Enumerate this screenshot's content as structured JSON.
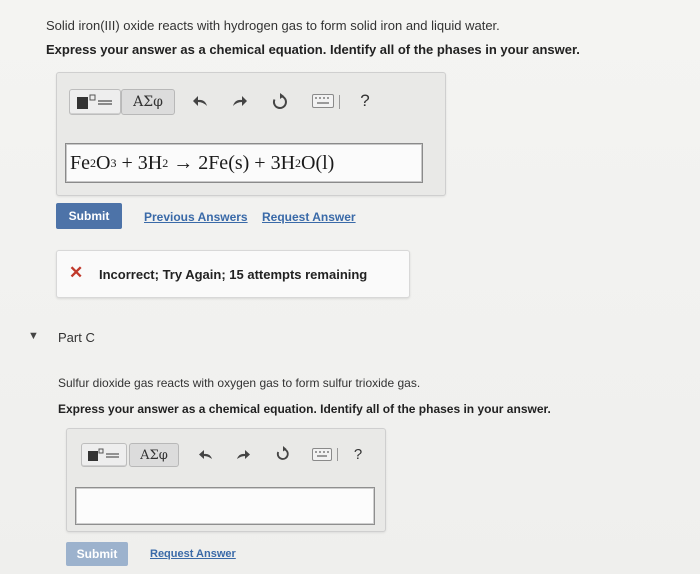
{
  "part_b": {
    "prompt": "Solid iron(III) oxide reacts with hydrogen gas to form solid iron and liquid water.",
    "instruction": "Express your answer as a chemical equation. Identify all of the phases in your answer.",
    "toolbar": {
      "greek_label": "ΑΣφ",
      "help_label": "?"
    },
    "equation": {
      "t1": "Fe",
      "s1": "2",
      "t2": "O",
      "s2": "3",
      "t3": " + 3H",
      "s3": "2",
      "t4": " → 2Fe(s) + 3H",
      "s4": "2",
      "t5": "O(l)"
    },
    "submit_label": "Submit",
    "previous_answers_label": "Previous Answers",
    "request_answer_label": "Request Answer",
    "feedback_icon": "✕",
    "feedback_text": "Incorrect; Try Again; 15 attempts remaining"
  },
  "part_c": {
    "caret": "▼",
    "title": "Part C",
    "prompt": "Sulfur dioxide gas reacts with oxygen gas to form sulfur trioxide gas.",
    "instruction": "Express your answer as a chemical equation. Identify all of the phases in your answer.",
    "toolbar": {
      "greek_label": "ΑΣφ",
      "help_label": "?"
    },
    "answer_value": "",
    "submit_label": "Submit",
    "request_answer_label": "Request Answer"
  },
  "colors": {
    "accent": "#4d73a8",
    "error": "#c0392b",
    "link": "#3a6aa8"
  },
  "icons": [
    "templates-icon",
    "undo-icon",
    "redo-icon",
    "reset-icon",
    "keyboard-icon",
    "close-icon",
    "caret-down-icon"
  ]
}
